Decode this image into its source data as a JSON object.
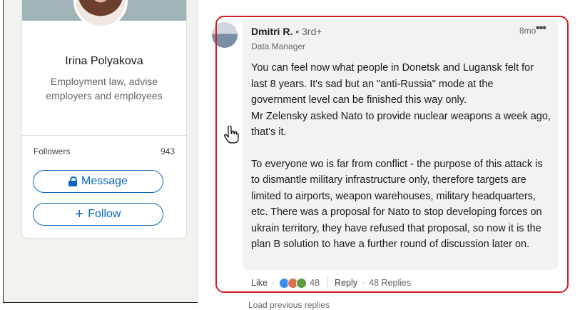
{
  "profile": {
    "name": "Irina Polyakova",
    "headline": "Employment law, advise employers and employees",
    "followers_label": "Followers",
    "followers_count": "943",
    "message_label": "Message",
    "follow_label": "Follow"
  },
  "comment": {
    "author": "Dmitri R.",
    "degree": "• 3rd+",
    "author_title": "Data Manager",
    "timestamp": "8mo",
    "more_label": "•••",
    "paragraphs": [
      "You can feel now what people in Donetsk and Lugansk felt for last 8 years. It's sad but an \"anti-Russia\" mode at the government level can be finished this way only.",
      "Mr Zelensky asked Nato to provide nuclear weapons a week ago, that's it.",
      "To everyone wo is far from conflict - the purpose of this attack is to dismantle military infrastructure only, therefore targets are limited to airports, weapon warehouses, military headquarters, etc. There was a proposal for Nato to stop developing forces on ukrain territory, they have refused that proposal, so now it is the plan B solution to have a further round of discussion later on."
    ],
    "actions": {
      "like_label": "Like",
      "dot": "·",
      "reaction_count": "48",
      "reply_label": "Reply",
      "replies_label": "48 Replies"
    }
  },
  "load_more_label": "Load previous replies",
  "colors": {
    "accent": "#0a66c2",
    "highlight": "#d71920",
    "bubble": "#f2f2f2",
    "page_bg": "#f3f2ef"
  }
}
